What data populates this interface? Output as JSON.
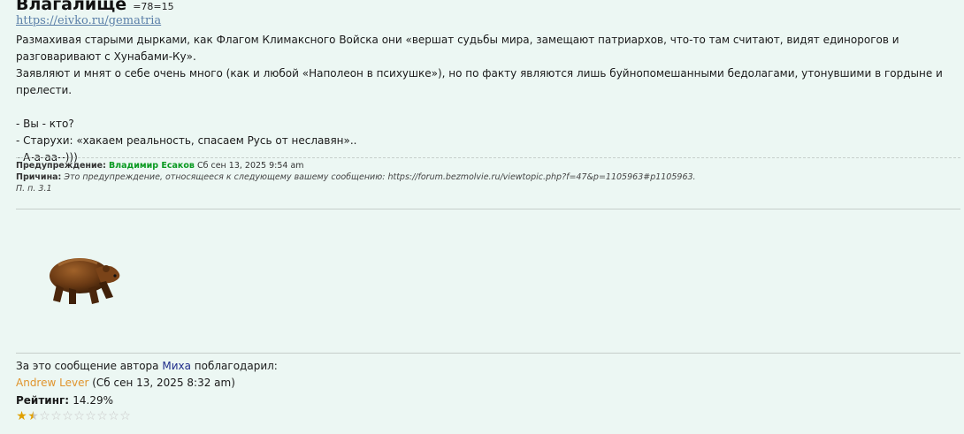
{
  "post": {
    "title": "Влагалище",
    "gematria": "=78=15",
    "link": "https://eivko.ru/gematria",
    "paragraphs": [
      "Размахивая старыми дырками, как Флагом Климаксного Войска они «вершат судьбы мира, замещают патриархов, что-то там считают, видят единорогов и разговаривают с Хунабами-Ку».",
      "Заявляют и мнят о себе очень много (как и любой «Наполеон в психушке»), но по факту являются лишь буйнопомешанными бедолагами, утонувшими в гордыне и прелести.",
      "",
      "- Вы - кто?",
      "- Старухи: «хакаем реальность, спасаем Русь от неславян»..",
      "- А-а-аа--)))"
    ]
  },
  "warning": {
    "label": "Предупреждение:",
    "moderator": "Владимир Есаков",
    "date": "Сб сен 13, 2025 9:54 am",
    "reason_label": "Причина:",
    "reason_text": "Это предупреждение, относящееся к следующему вашему сообщению: https://forum.bezmolvie.ru/viewtopic.php?f=47&p=1105963#p1105963.",
    "clause": "П. п. 3.1"
  },
  "thanks": {
    "prefix": "За это сообщение автора",
    "author": "Миха",
    "suffix": "поблагодарил:",
    "user": "Andrew Lever",
    "date": "(Сб сен 13, 2025 8:32 am)"
  },
  "rating": {
    "label": "Рейтинг:",
    "value": "14.29%",
    "stars_total": 10,
    "stars_value": 1.5
  },
  "colors": {
    "background": "#ecf7f3",
    "moderator": "#0a9a22",
    "thanks_user": "#e0942c",
    "author": "#1e2c8a",
    "link": "#5a7fa8"
  }
}
